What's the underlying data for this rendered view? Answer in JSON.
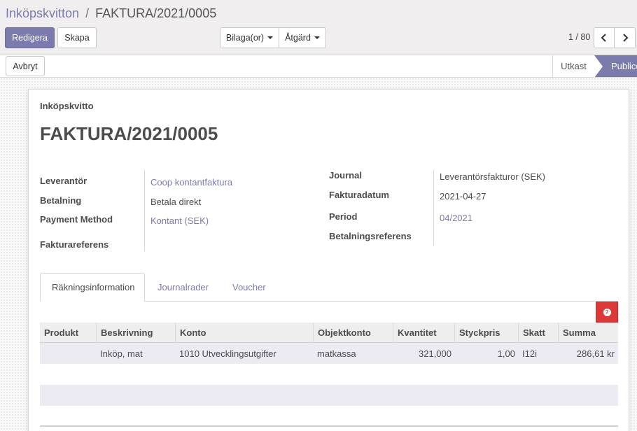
{
  "breadcrumb": {
    "parent": "Inköpskvitton",
    "separator": "/",
    "current": "FAKTURA/2021/0005"
  },
  "toolbar": {
    "edit_label": "Redigera",
    "create_label": "Skapa",
    "attachments_label": "Bilaga(or)",
    "action_label": "Åtgärd"
  },
  "pager": {
    "value": "1 / 80",
    "prev_icon": "chevron-left-icon",
    "next_icon": "chevron-right-icon"
  },
  "statusbar": {
    "cancel_label": "Avbryt",
    "steps": [
      "Utkast",
      "Publicerad"
    ],
    "active_step": "Publicerad"
  },
  "form": {
    "doc_type": "Inköpskvitto",
    "title": "FAKTURA/2021/0005",
    "left_fields": [
      {
        "label": "Leverantör",
        "value": "Coop kontantfaktura",
        "is_link": true
      },
      {
        "label": "Betalning",
        "value": "Betala direkt",
        "is_link": false
      },
      {
        "label": "Payment Method",
        "value": "Kontant (SEK)",
        "is_link": true
      },
      {
        "label": "Fakturareferens",
        "value": "",
        "is_link": false
      }
    ],
    "right_fields": [
      {
        "label": "Journal",
        "value": "Leverantörsfakturor (SEK)",
        "is_link": false
      },
      {
        "label": "Fakturadatum",
        "value": "2021-04-27",
        "is_link": false
      },
      {
        "label": "Period",
        "value": "04/2021",
        "is_link": true
      },
      {
        "label": "Betalningsreferens",
        "value": "",
        "is_link": false
      }
    ]
  },
  "tabs": [
    {
      "label": "Räkningsinformation",
      "active": true
    },
    {
      "label": "Journalrader",
      "active": false
    },
    {
      "label": "Voucher",
      "active": false
    }
  ],
  "help_button": {
    "icon": "question-circle-icon"
  },
  "table": {
    "columns": [
      "Produkt",
      "Beskrivning",
      "Konto",
      "Objektkonto",
      "Kvantitet",
      "Styckpris",
      "Skatt",
      "Summa"
    ],
    "rows": [
      {
        "product": "",
        "description": "Inköp, mat",
        "account": "1010 Utvecklingsutgifter",
        "analytic": "matkassa",
        "quantity": "321,000",
        "unit_price": "1,00",
        "tax": "I12i",
        "total": "286,61 kr"
      }
    ]
  },
  "colors": {
    "accent": "#7c7bad",
    "help": "#dc3838"
  }
}
